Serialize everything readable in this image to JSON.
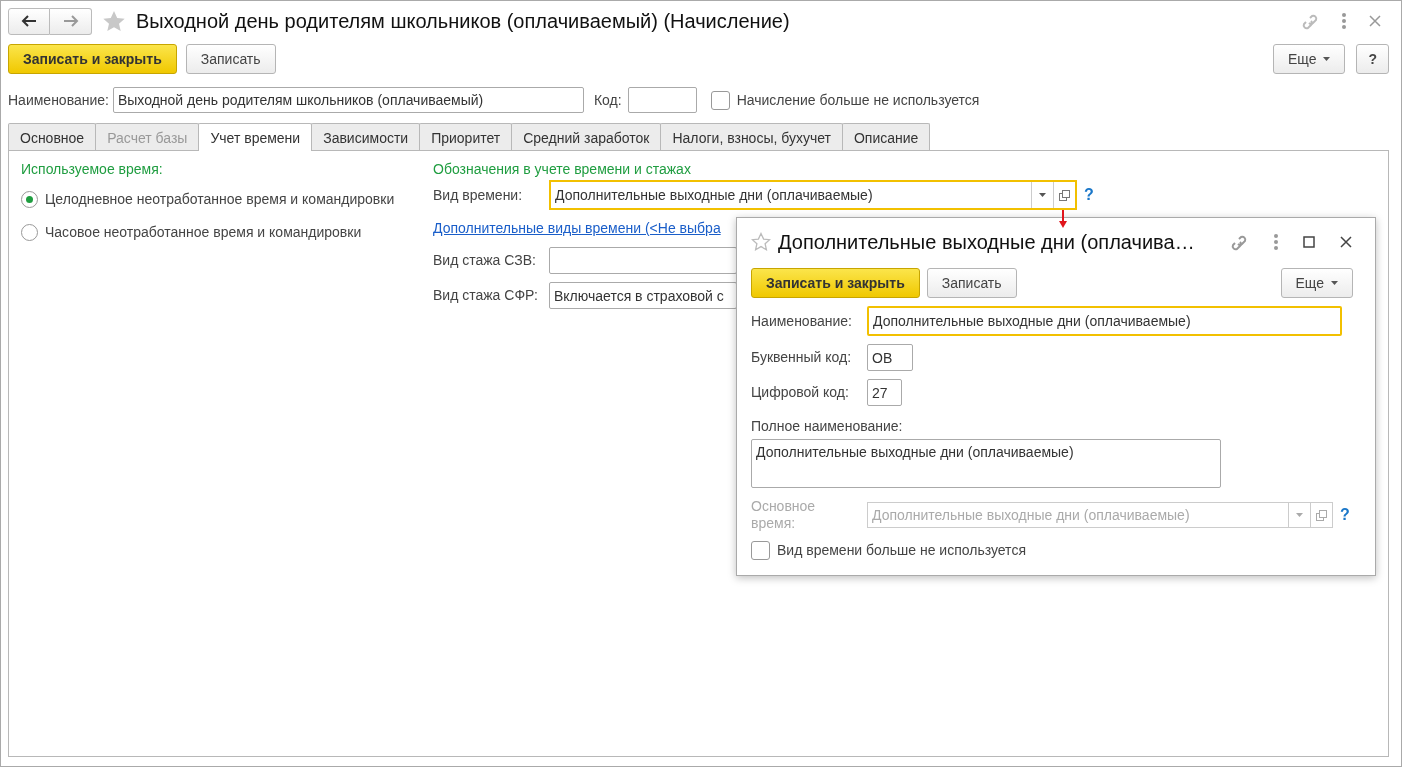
{
  "window": {
    "title": "Выходной день родителям школьников (оплачиваемый) (Начисление)"
  },
  "toolbar": {
    "buttons": [
      {
        "label": "Записать и закрыть",
        "kind": "primary"
      },
      {
        "label": "Записать",
        "kind": "default"
      }
    ],
    "more": "Еще",
    "help": "?"
  },
  "header": {
    "name_label": "Наименование:",
    "name_value": "Выходной день родителям школьников (оплачиваемый)",
    "code_label": "Код:",
    "unused": {
      "label": "Начисление больше не используется",
      "checked": false
    }
  },
  "tabs": [
    {
      "label": "Основное",
      "selected": false,
      "disabled": false
    },
    {
      "label": "Расчет базы",
      "selected": false,
      "disabled": true
    },
    {
      "label": "Учет времени",
      "selected": true,
      "disabled": false
    },
    {
      "label": "Зависимости",
      "selected": false,
      "disabled": false
    },
    {
      "label": "Приоритет",
      "selected": false,
      "disabled": false
    },
    {
      "label": "Средний заработок",
      "selected": false,
      "disabled": false
    },
    {
      "label": "Налоги, взносы, бухучет",
      "selected": false,
      "disabled": false
    },
    {
      "label": "Описание",
      "selected": false,
      "disabled": false
    }
  ],
  "used_time": {
    "title": "Используемое время:",
    "options": [
      {
        "label": "Целодневное неотработанное время и командировки",
        "selected": true
      },
      {
        "label": "Часовое неотработанное время и командировки",
        "selected": false
      }
    ]
  },
  "designations": {
    "title": "Обозначения в учете времени и стажах",
    "time_type": {
      "label": "Вид времени:",
      "value": "Дополнительные выходные дни (оплачиваемые)",
      "help": "?"
    },
    "link": "Дополнительные виды времени (<Не выбра",
    "szv": {
      "label": "Вид стажа СЗВ:"
    },
    "sfr": {
      "label": "Вид стажа СФР:",
      "value": "Включается в страховой с"
    }
  },
  "dialog": {
    "title": "Дополнительные выходные дни (оплачива…",
    "buttons": [
      {
        "label": "Записать и закрыть",
        "kind": "primary"
      },
      {
        "label": "Записать",
        "kind": "default"
      }
    ],
    "more": "Еще",
    "name": {
      "label": "Наименование:",
      "value": "Дополнительные выходные дни (оплачиваемые)"
    },
    "letter_code": {
      "label": "Буквенный код:",
      "value": "ОВ"
    },
    "digit_code": {
      "label": "Цифровой код:",
      "value": "27"
    },
    "full_name": {
      "label": "Полное наименование:",
      "value": "Дополнительные выходные дни (оплачиваемые)"
    },
    "base_time": {
      "label": "Основное время:",
      "value": "Дополнительные выходные дни (оплачиваемые)",
      "disabled": true,
      "help": "?"
    },
    "unused": {
      "label": "Вид времени больше не используется",
      "checked": false
    }
  }
}
